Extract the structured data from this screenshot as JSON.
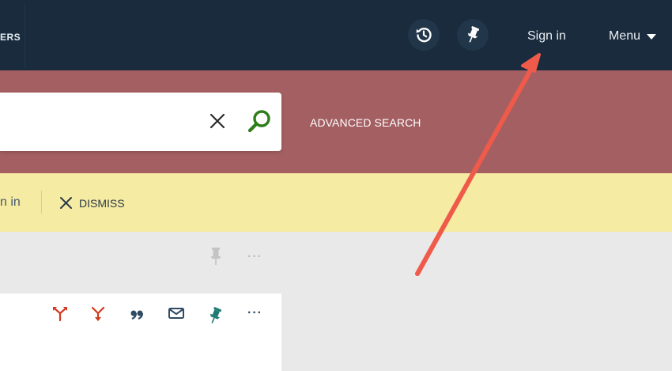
{
  "header": {
    "brand_fragment": "ERS",
    "history_icon": "history-icon",
    "pin_icon": "pin-icon",
    "signin_label": "Sign in",
    "menu_label": "Menu",
    "menu_icon": "caret-down-icon"
  },
  "search": {
    "query": "",
    "clear_icon": "close-icon",
    "search_icon": "search-icon",
    "advanced_label": "ADVANCED SEARCH"
  },
  "notice": {
    "signin_fragment": "n in",
    "dismiss_label": "DISMISS",
    "dismiss_icon": "close-icon"
  },
  "results": {
    "row_actions": [
      "pin-icon",
      "more-options-icon"
    ],
    "row_more_label": "···",
    "card_actions": [
      "citation-trail-icon",
      "times-cited-icon",
      "citation-icon",
      "email-icon",
      "pin-icon",
      "more-options-icon"
    ],
    "card_more_label": "···"
  },
  "colors": {
    "topbar": "#192b3d",
    "search_band": "#a45f62",
    "notice_bar": "#f6eba2",
    "results_bg": "#e9e9e9",
    "search_icon": "#2e7d1a",
    "action_red": "#d13a1f",
    "action_teal": "#1d7a73",
    "action_navy": "#2f4a63",
    "annotation_arrow": "#ef5a4a"
  }
}
